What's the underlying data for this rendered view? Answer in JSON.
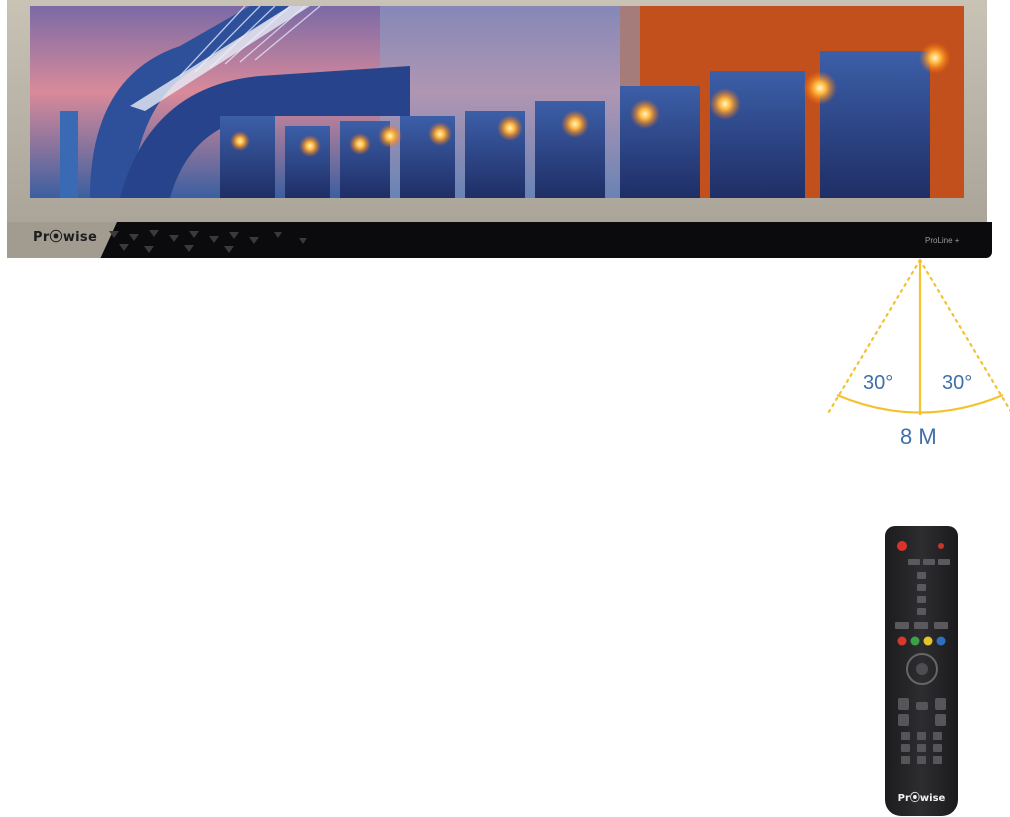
{
  "display": {
    "brand": "Pr⦿wise",
    "model": "ProLine +"
  },
  "viewing": {
    "angle_left": "30°",
    "angle_right": "30°",
    "distance": "8 M"
  },
  "remote": {
    "brand": "Pr⦿wise"
  },
  "colors": {
    "bezel": "#b7b1a5",
    "bar": "#0b0b0d",
    "angle_lines": "#f4c22e",
    "label_blue": "#3f6fa8",
    "remote": "#222225"
  }
}
